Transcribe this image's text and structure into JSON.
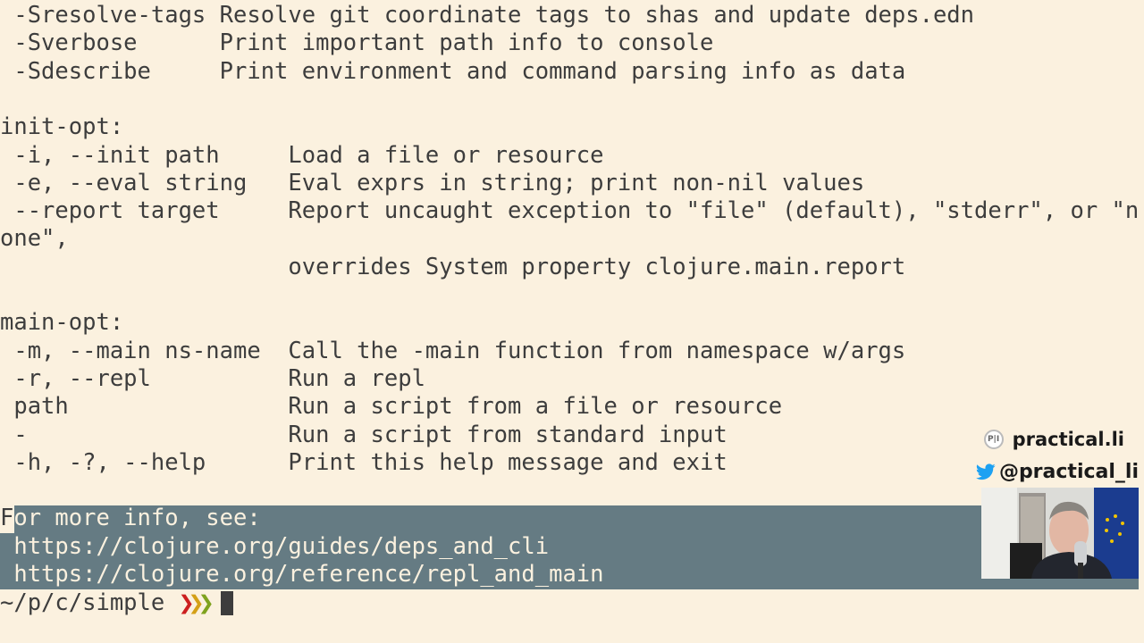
{
  "terminal": {
    "lines": [
      " -Sresolve-tags Resolve git coordinate tags to shas and update deps.edn",
      " -Sverbose      Print important path info to console",
      " -Sdescribe     Print environment and command parsing info as data",
      "",
      "init-opt:",
      " -i, --init path     Load a file or resource",
      " -e, --eval string   Eval exprs in string; print non-nil values",
      " --report target     Report uncaught exception to \"file\" (default), \"stderr\", or \"n",
      "one\",",
      "                     overrides System property clojure.main.report",
      "",
      "main-opt:",
      " -m, --main ns-name  Call the -main function from namespace w/args",
      " -r, --repl          Run a repl",
      " path                Run a script from a file or resource",
      " -                   Run a script from standard input",
      " -h, -?, --help      Print this help message and exit",
      ""
    ],
    "selected_lines": [
      "For more info, see:",
      " https://clojure.org/guides/deps_and_cli",
      " https://clojure.org/reference/repl_and_main"
    ],
    "prompt": {
      "path": "~/p/c/simple",
      "chevrons": [
        "❯",
        "❯",
        "❯"
      ],
      "chevron_colors": [
        "#cc1f1f",
        "#d4a017",
        "#7fa21e"
      ]
    },
    "colors": {
      "background": "#fbf1df",
      "foreground": "#3d3d3d",
      "selection": "#657b83"
    }
  },
  "overlay": {
    "brand": "practical.li",
    "brand_logo_text": "P|I",
    "twitter_handle": "@practical_li",
    "twitter_color": "#1da1f2",
    "webcam_icon": "webcam-presenter"
  }
}
